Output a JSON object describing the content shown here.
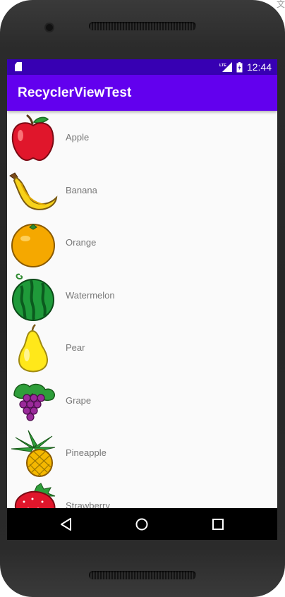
{
  "status_bar": {
    "time": "12:44",
    "network_label": "LTE",
    "icons": [
      "sd-card-icon",
      "lte-signal-icon",
      "battery-icon"
    ]
  },
  "app_bar": {
    "title": "RecyclerViewTest",
    "color": "#6200ee",
    "status_color": "#3700b3"
  },
  "fruits": [
    {
      "name": "Apple",
      "icon": "apple-icon"
    },
    {
      "name": "Banana",
      "icon": "banana-icon"
    },
    {
      "name": "Orange",
      "icon": "orange-icon"
    },
    {
      "name": "Watermelon",
      "icon": "watermelon-icon"
    },
    {
      "name": "Pear",
      "icon": "pear-icon"
    },
    {
      "name": "Grape",
      "icon": "grape-icon"
    },
    {
      "name": "Pineapple",
      "icon": "pineapple-icon"
    },
    {
      "name": "Strawberry",
      "icon": "strawberry-icon"
    }
  ],
  "nav_bar": {
    "buttons": [
      "back-icon",
      "home-icon",
      "recents-icon"
    ]
  },
  "corner_glyph": "文"
}
